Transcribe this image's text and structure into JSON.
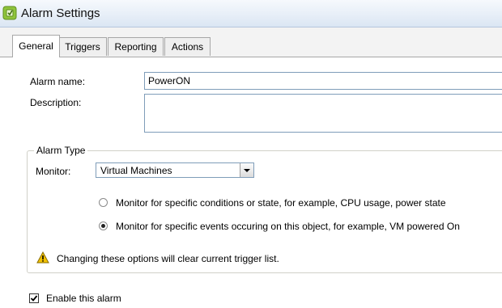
{
  "window": {
    "title": "Alarm Settings",
    "icon": "alarm-settings-icon"
  },
  "tabs": [
    {
      "label": "General",
      "active": true
    },
    {
      "label": "Triggers",
      "active": false
    },
    {
      "label": "Reporting",
      "active": false
    },
    {
      "label": "Actions",
      "active": false
    }
  ],
  "general": {
    "alarm_name_label": "Alarm name:",
    "alarm_name_value": "PowerON",
    "description_label": "Description:",
    "description_value": ""
  },
  "alarm_type": {
    "group_title": "Alarm Type",
    "monitor_label": "Monitor:",
    "monitor_value": "Virtual Machines",
    "options": [
      {
        "label": "Monitor for specific conditions or state, for example, CPU usage, power state",
        "selected": false
      },
      {
        "label": "Monitor for specific events occuring on this object, for example, VM powered On",
        "selected": true
      }
    ],
    "warning_text": "Changing these options will clear current trigger list.",
    "warning_icon": "warning-icon"
  },
  "enable_alarm": {
    "label": "Enable this alarm",
    "checked": true
  },
  "colors": {
    "title_bar": "#dbe6f3",
    "field_border": "#7f9db9",
    "warning": "#f2c200"
  }
}
